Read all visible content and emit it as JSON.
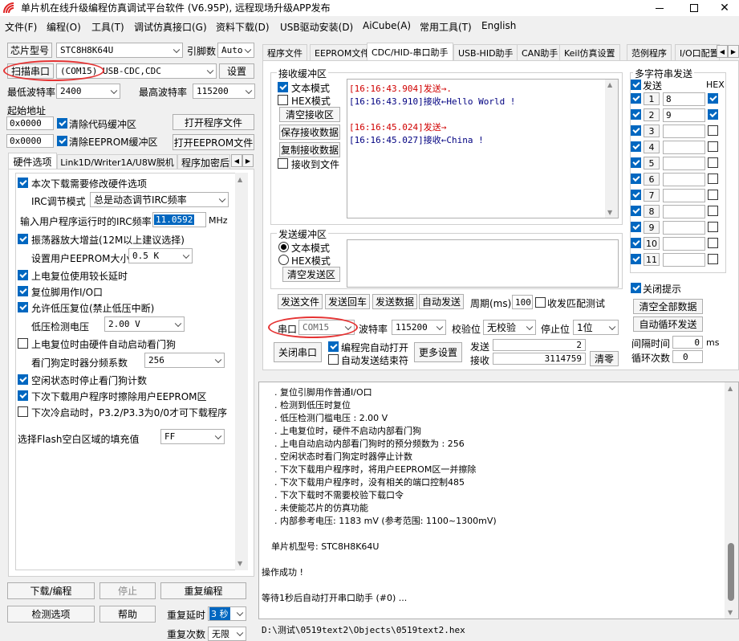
{
  "title": "单片机在线升级编程仿真调试平台软件 (V6.95P), 远程现场升级APP发布",
  "menu": [
    "文件(F)",
    "编程(O)",
    "工具(T)",
    "调试仿真接口(G)",
    "资料下载(D)",
    "USB驱动安装(D)",
    "AiCube(A)",
    "常用工具(T)",
    "English"
  ],
  "left": {
    "chip_btn": "芯片型号",
    "chip_value": "STC8H8K64U",
    "pin_label": "引脚数",
    "pin_value": "Auto",
    "scan_btn": "扫描串口",
    "port_value": "(COM15) USB-CDC,CDC",
    "settings_btn": "设置",
    "min_baud_label": "最低波特率",
    "min_baud": "2400",
    "max_baud_label": "最高波特率",
    "max_baud": "115200",
    "start_addr_label": "起始地址",
    "addr1": "0x0000",
    "clear_code": "清除代码缓冲区",
    "open_prog": "打开程序文件",
    "addr2": "0x0000",
    "clear_eeprom": "清除EEPROM缓冲区",
    "open_eeprom": "打开EEPROM文件",
    "tabs": [
      "硬件选项",
      "Link1D/Writer1A/U8W脱机",
      "程序加密后"
    ],
    "opts": {
      "o1": "本次下载需要修改硬件选项",
      "irc_mode_label": "IRC调节模式",
      "irc_mode": "总是动态调节IRC频率",
      "irc_freq_label": "输入用户程序运行时的IRC频率",
      "irc_freq": "11.0592",
      "irc_unit": "MHz",
      "o2": "振荡器放大增益(12M以上建议选择)",
      "eeprom_size_label": "设置用户EEPROM大小",
      "eeprom_size": "0.5 K",
      "o3": "上电复位使用较长延时",
      "o4": "复位脚用作I/O口",
      "o5": "允许低压复位(禁止低压中断)",
      "lv_label": "低压检测电压",
      "lv_value": "2.00 V",
      "o6": "上电复位时由硬件自动启动看门狗",
      "wdt_label": "看门狗定时器分频系数",
      "wdt_value": "256",
      "o7": "空闲状态时停止看门狗计数",
      "o8": "下次下载用户程序时擦除用户EEPROM区",
      "o9": "下次冷启动时，P3.2/P3.3为0/0才可下载程序",
      "fill_label": "选择Flash空白区域的填充值",
      "fill_value": "FF"
    },
    "download_btn": "下载/编程",
    "stop_btn": "停止",
    "reprog_btn": "重复编程",
    "check_btn": "检测选项",
    "help_btn": "帮助",
    "delay_label": "重复延时",
    "delay_value": "3 秒",
    "repeat_label": "重复次数",
    "repeat_value": "无限"
  },
  "right": {
    "tabs": [
      "程序文件",
      "EEPROM文件",
      "CDC/HID-串口助手",
      "USB-HID助手",
      "CAN助手",
      "Keil仿真设置",
      "范例程序",
      "I/O口配置"
    ],
    "recv_group": "接收缓冲区",
    "text_mode": "文本模式",
    "hex_mode": "HEX模式",
    "clear_recv": "清空接收区",
    "save_recv": "保存接收数据",
    "copy_recv": "复制接收数据",
    "recv_file": "接收到文件",
    "recv_lines": [
      {
        "t": "[16:16:43.904]发送→.",
        "c": "#d00000"
      },
      {
        "t": "[16:16:43.910]接收←Hello World !",
        "c": "#000080"
      },
      {
        "t": "[16:16:45.024]发送→",
        "c": "#d00000"
      },
      {
        "t": "[16:16:45.027]接收←China !",
        "c": "#000080"
      }
    ],
    "send_group": "发送缓冲区",
    "s_text_mode": "文本模式",
    "s_hex_mode": "HEX模式",
    "clear_send": "清空发送区",
    "send_file": "发送文件",
    "send_back": "发送回车",
    "send_data": "发送数据",
    "auto_send": "自动发送",
    "period_label": "周期(ms)",
    "period": "100",
    "recv_match": "收发匹配测试",
    "port_label": "串口",
    "port": "COM15",
    "baud_label": "波特率",
    "baud": "115200",
    "parity_label": "校验位",
    "parity": "无校验",
    "stop_label": "停止位",
    "stop": "1位",
    "close_port": "关闭串口",
    "auto_open": "编程完自动打开",
    "auto_end": "自动发送结束符",
    "more_settings": "更多设置",
    "send_count_label": "发送",
    "send_count": "2",
    "recv_count_label": "接收",
    "recv_count": "3114759",
    "clear_count": "清零",
    "multi_group": "多字符串发送",
    "send_col": "发送",
    "hex_col": "HEX",
    "multi": [
      {
        "n": "1",
        "v": "8",
        "hex": true
      },
      {
        "n": "2",
        "v": "9",
        "hex": true
      },
      {
        "n": "3",
        "v": "",
        "hex": false
      },
      {
        "n": "4",
        "v": "",
        "hex": false
      },
      {
        "n": "5",
        "v": "",
        "hex": false
      },
      {
        "n": "6",
        "v": "",
        "hex": false
      },
      {
        "n": "7",
        "v": "",
        "hex": false
      },
      {
        "n": "8",
        "v": "",
        "hex": false
      },
      {
        "n": "9",
        "v": "",
        "hex": false
      },
      {
        "n": "10",
        "v": "",
        "hex": false
      },
      {
        "n": "11",
        "v": "",
        "hex": false
      }
    ],
    "close_tip": "关闭提示",
    "clear_all": "清空全部数据",
    "auto_loop": "自动循环发送",
    "interval_label": "间隔时间",
    "interval": "0",
    "interval_unit": "ms",
    "loop_label": "循环次数",
    "loop": "0"
  },
  "log": [
    ". 复位引脚用作普通I/O口",
    ". 检测到低压时复位",
    ". 低压检测门槛电压 : 2.00 V",
    ". 上电复位时，硬件不启动内部看门狗",
    ". 上电自动启动内部看门狗时的预分频数为 : 256",
    ". 空闲状态时看门狗定时器停止计数",
    ". 下次下载用户程序时，将用户EEPROM区一并擦除",
    ". 下次下载用户程序时，没有相关的端口控制485",
    ". 下次下载时不需要校验下载口令",
    ". 未使能芯片的仿真功能",
    ". 内部参考电压: 1183 mV (参考范围: 1100~1300mV)",
    "单片机型号: STC8H8K64U",
    "操作成功 !",
    "等待1秒后自动打开串口助手 (#0) ..."
  ],
  "status_path": "D:\\测试\\0519text2\\Objects\\0519text2.hex"
}
